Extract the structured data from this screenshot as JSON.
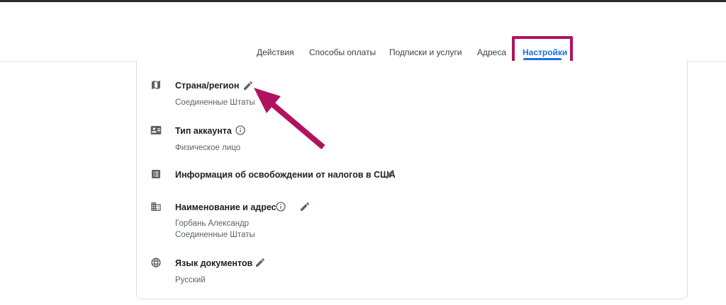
{
  "tabs": [
    {
      "label": "Действия"
    },
    {
      "label": "Способы оплаты"
    },
    {
      "label": "Подписки и услуги"
    },
    {
      "label": "Адреса"
    },
    {
      "label": "Настройки",
      "active": true
    }
  ],
  "settings": {
    "country": {
      "title": "Страна/регион",
      "value": "Соединенные Штаты",
      "icon": "map-icon"
    },
    "account_type": {
      "title": "Тип аккаунта",
      "value": "Физическое лицо",
      "icon": "id-card-icon"
    },
    "tax_exemption": {
      "title": "Информация об освобождении от налогов в США",
      "icon": "list-icon"
    },
    "name_address": {
      "title": "Наименование и адрес",
      "name": "Горбань Александр",
      "country": "Соединенные Штаты",
      "icon": "building-icon"
    },
    "doc_language": {
      "title": "Язык документов",
      "value": "Русский",
      "icon": "globe-icon"
    }
  },
  "colors": {
    "accent": "#1a73e8",
    "annotation": "#b0135e"
  }
}
